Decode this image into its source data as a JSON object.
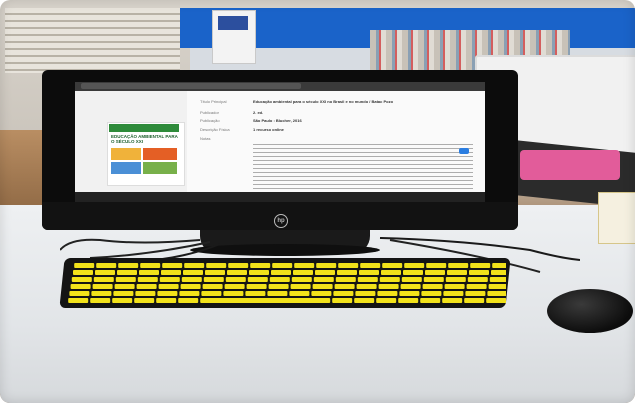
{
  "screen": {
    "book_cover_title": "EDUCAÇÃO AMBIENTAL PARA O SÉCULO XXI",
    "meta_labels": [
      "Título Principal",
      "Publicador",
      "Publicação",
      "Descrição Física",
      "Notas"
    ],
    "meta_values": [
      "Educação ambiental para o século XXI no Brasil e no mundo / Batac Pozo",
      "2. ed.",
      "São Paulo : Blucher, 2016",
      "1 recurso online"
    ]
  },
  "monitor": {
    "brand": "hp"
  },
  "colors": {
    "keyboard_keys": "#f2e21a",
    "keyboard_body": "#141414",
    "wall_blue": "#1a63c9",
    "cover_green": "#2e8b3a"
  },
  "keyboard": {
    "rows": 6,
    "keys_per_row": 20
  }
}
